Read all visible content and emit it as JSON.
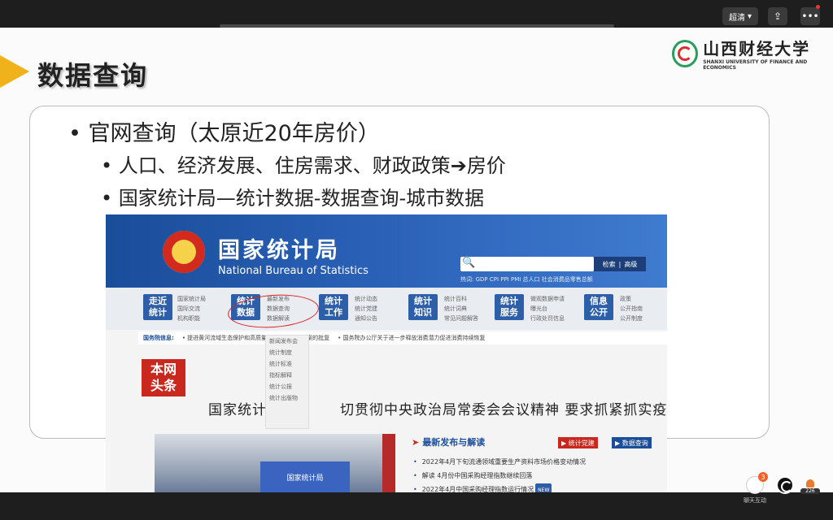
{
  "player": {
    "quality_label": "超清",
    "share_icon": "share-icon",
    "more_icon": "more-dots-icon",
    "chat_label": "聊天互动",
    "chat_badge": "3",
    "viewer_count": "226"
  },
  "slide": {
    "title": "数据查询",
    "logo_cn": "山西财经大学",
    "logo_en": "SHANXI UNIVERSITY OF FINANCE AND ECONOMICS",
    "bullet1": "• 官网查询（太原近20年房价）",
    "bullet2a_text": "• 人口、经济发展、住房需求、财政政策",
    "bullet2a_arrow": "➔",
    "bullet2a_tail": "房价",
    "bullet2b": "• 国家统计局—统计数据-数据查询-城市数据"
  },
  "nbs": {
    "name_cn": "国家统计局",
    "name_en": "National Bureau of Statistics",
    "search_buttons": [
      "检索",
      "高级"
    ],
    "hot_words": "热词: GDP   CPI   PPI   PMI   总人口   社会消费品零售总额",
    "nav": [
      {
        "tile": "走近\n统计",
        "links": [
          "国家统计局",
          "国际交流",
          "机构职能"
        ]
      },
      {
        "tile": "统计\n数据",
        "links": [
          "最新发布",
          "数据查询",
          "数据解读"
        ]
      },
      {
        "tile": "统计\n工作",
        "links": [
          "统计动态",
          "统计党建",
          "通知公告"
        ]
      },
      {
        "tile": "统计\n知识",
        "links": [
          "统计百科",
          "统计词典",
          "常见问题解答"
        ]
      },
      {
        "tile": "统计\n服务",
        "links": [
          "微观数据申请",
          "曝光台",
          "行政处罚信息"
        ]
      },
      {
        "tile": "信息\n公开",
        "links": [
          "政策",
          "公开指南",
          "公开制度"
        ]
      }
    ],
    "ticker_label": "国务院信息:",
    "ticker_items": [
      "•  提进黄河流域生态保护和高质量发展行区实施方案的批复",
      "•  国务院办公厅关于进一步释放消费潜力促进消费持续恢复"
    ],
    "dropdown": [
      "新闻发布会",
      "统计制度",
      "统计标准",
      "指标解释",
      "统计公报",
      "统计出版物"
    ],
    "headline_box": "本网\n头条",
    "headline": "国家统计局　　　　切贯彻中央政治局常委会会议精神 要求抓紧抓实疫情防控工作",
    "photo_text": "国家统计局",
    "news_head": "最新发布与解读",
    "tag_red": "统计党建",
    "tag_blue": "数据查询",
    "news": [
      "2022年4月下旬流通领域重要生产资料市场价格变动情况",
      "解读   4月份中国采购经理指数继续回落",
      "2022年4月中国采购经理指数运行情况"
    ],
    "news_new_badge": "NEW"
  }
}
